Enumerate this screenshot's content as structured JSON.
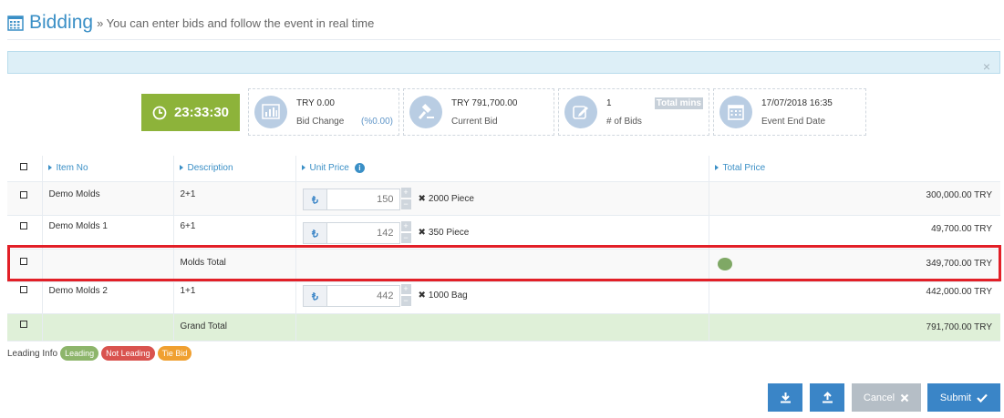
{
  "header": {
    "title": "Bidding",
    "subtitle": "» You can enter bids and follow the event in real time",
    "icon": "calendar-grid-icon"
  },
  "alert": {
    "close": "×"
  },
  "timer": {
    "value": "23:33:30",
    "icon": "clock-icon"
  },
  "stats": [
    {
      "line1": "TRY 0.00",
      "line2": "Bid Change",
      "extra": "(%0.00)",
      "icon": "bar-chart-icon"
    },
    {
      "line1": "TRY 791,700.00",
      "line2": "Current Bid",
      "icon": "gavel-icon"
    },
    {
      "line1": "1",
      "line2": "# of Bids",
      "extra": "Total mins",
      "icon": "edit-icon"
    },
    {
      "line1": "17/07/2018 16:35",
      "line2": "Event End Date",
      "icon": "calendar-icon"
    }
  ],
  "table": {
    "headers": {
      "item_no": "Item No",
      "description": "Description",
      "unit_price": "Unit Price",
      "total_price": "Total Price"
    },
    "rows": [
      {
        "item": "Demo Molds",
        "desc": "2+1",
        "price": "150",
        "qty": "2000 Piece",
        "total": "300,000.00 TRY"
      },
      {
        "item": "Demo Molds 1",
        "desc": "6+1",
        "price": "142",
        "qty": "350 Piece",
        "total": "49,700.00 TRY"
      },
      {
        "item": "",
        "desc": "Molds Total",
        "total": "349,700.00 TRY"
      },
      {
        "item": "Demo Molds 2",
        "desc": "1+1",
        "price": "442",
        "qty": "1000 Bag",
        "total": "442,000.00 TRY"
      },
      {
        "item": "",
        "desc": "Grand Total",
        "total": "791,700.00 TRY"
      }
    ],
    "qty_prefix": "✖",
    "step_plus": "+",
    "step_minus": "−"
  },
  "legend": {
    "label": "Leading Info",
    "items": [
      {
        "text": "Leading",
        "color": "#8db56b"
      },
      {
        "text": "Not Leading",
        "color": "#d9534f"
      },
      {
        "text": "Tie Bid",
        "color": "#f0a030"
      }
    ]
  },
  "buttons": {
    "download": "download-icon",
    "upload": "upload-icon",
    "cancel": "Cancel",
    "submit": "Submit"
  },
  "colors": {
    "accent": "#3a8fc6",
    "timer": "#8db33a",
    "highlight": "#e21f27",
    "leading": "#7fa865"
  }
}
